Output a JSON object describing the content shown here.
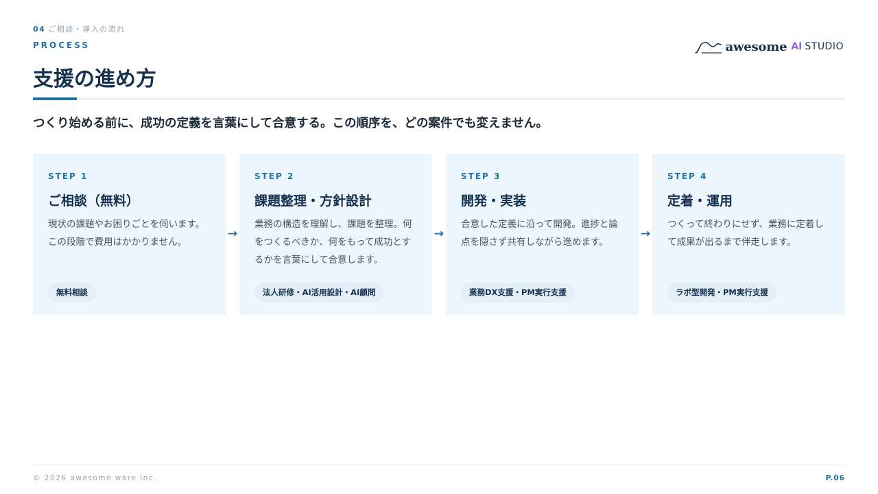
{
  "header": {
    "section_number": "04",
    "section_label": "ご相談・導入の流れ",
    "kicker": "PROCESS",
    "title": "支援の進め方"
  },
  "logo": {
    "brand": "awesome",
    "ai": "AI",
    "studio": "STUDIO"
  },
  "lead": "つくり始める前に、成功の定義を言葉にして合意する。この順序を、どの案件でも変えません。",
  "steps": [
    {
      "label": "STEP 1",
      "heading": "ご相談（無料）",
      "description": "現状の課題やお困りごとを伺います。この段階で費用はかかりません。",
      "tag": "無料相談"
    },
    {
      "label": "STEP 2",
      "heading": "課題整理・方針設計",
      "description": "業務の構造を理解し、課題を整理。何をつくるべきか、何をもって成功とするかを言葉にして合意します。",
      "tag": "法人研修・AI活用設計・AI顧問"
    },
    {
      "label": "STEP 3",
      "heading": "開発・実装",
      "description": "合意した定義に沿って開発。進捗と論点を隠さず共有しながら進めます。",
      "tag": "業務DX支援・PM実行支援"
    },
    {
      "label": "STEP 4",
      "heading": "定着・運用",
      "description": "つくって終わりにせず、業務に定着して成果が出るまで伴走します。",
      "tag": "ラボ型開発・PM実行支援"
    }
  ],
  "arrow_glyph": "→",
  "footer": {
    "copyright": "© 2026 awesome ware Inc.",
    "page": "P.06"
  },
  "colors": {
    "accent": "#1f6fa8",
    "title": "#15314f",
    "card_bg": "#eef6fd",
    "ai_purple": "#9b5de5"
  }
}
